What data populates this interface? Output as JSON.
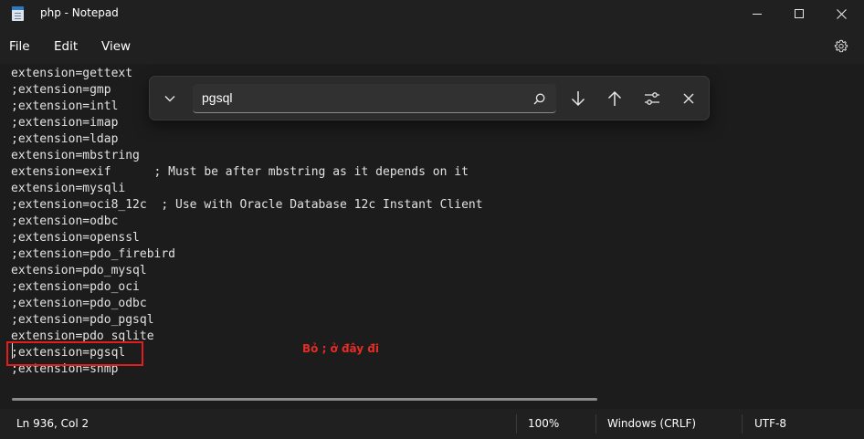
{
  "window": {
    "title": "php - Notepad"
  },
  "menu": {
    "file": "File",
    "edit": "Edit",
    "view": "View"
  },
  "editor": {
    "lines": [
      "extension=gettext",
      ";extension=gmp",
      ";extension=intl",
      ";extension=imap",
      ";extension=ldap",
      "extension=mbstring",
      "extension=exif      ; Must be after mbstring as it depends on it",
      "extension=mysqli",
      ";extension=oci8_12c  ; Use with Oracle Database 12c Instant Client",
      ";extension=odbc",
      ";extension=openssl",
      ";extension=pdo_firebird",
      "extension=pdo_mysql",
      ";extension=pdo_oci",
      ";extension=pdo_odbc",
      ";extension=pdo_pgsql",
      "extension=pdo_sqlite",
      ";extension=pgsql",
      ";extension=snmp"
    ],
    "annotation": "Bỏ ; ở đây đi"
  },
  "find": {
    "query": "pgsql"
  },
  "status": {
    "position": "Ln 936, Col 2",
    "zoom": "100%",
    "line_ending": "Windows (CRLF)",
    "encoding": "UTF-8"
  },
  "colors": {
    "background": "#1c1c1c",
    "chrome": "#202020",
    "annotation_red": "#e21d1d"
  }
}
